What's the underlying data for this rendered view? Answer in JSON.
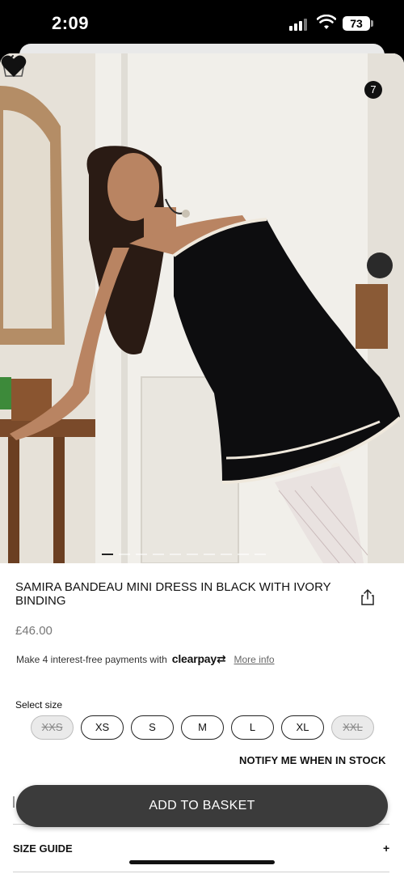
{
  "status_bar": {
    "time": "2:09",
    "battery": "73"
  },
  "header": {
    "basket_count": "7"
  },
  "product": {
    "title": "SAMIRA BANDEAU MINI DRESS IN BLACK WITH IVORY BINDING",
    "price": "£46.00",
    "payment_text": "Make 4 interest-free payments with",
    "payment_brand": "clearpay",
    "more_info": "More info",
    "gallery": {
      "image_count": 10,
      "active_index": 0
    }
  },
  "size_selector": {
    "label": "Select size",
    "sizes": [
      {
        "label": "XXS",
        "available": false
      },
      {
        "label": "XS",
        "available": true
      },
      {
        "label": "S",
        "available": true
      },
      {
        "label": "M",
        "available": true
      },
      {
        "label": "L",
        "available": true
      },
      {
        "label": "XL",
        "available": true
      },
      {
        "label": "XXL",
        "available": false
      }
    ]
  },
  "notify_label": "NOTIFY ME WHEN IN STOCK",
  "add_to_basket": "ADD TO BASKET",
  "size_guide": {
    "label": "SIZE GUIDE",
    "toggle": "+"
  },
  "colors": {
    "button": "#3b3b3b",
    "unavailable": "#eaeaea",
    "text": "#111111"
  }
}
